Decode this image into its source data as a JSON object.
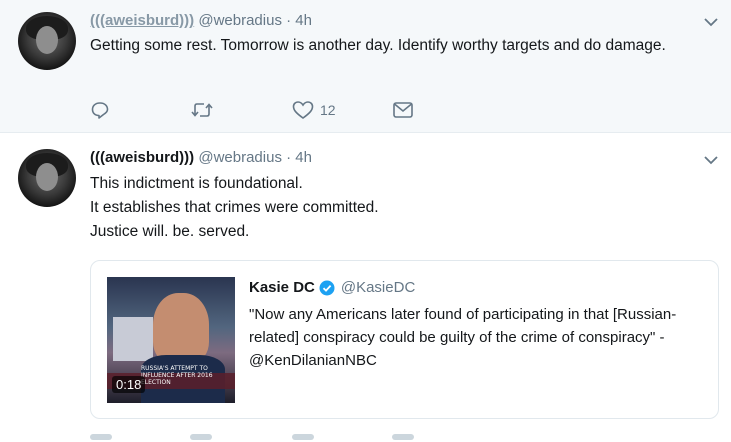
{
  "tweet1": {
    "display_name": "(((aweisburd)))",
    "handle": "@webradius",
    "separator": "·",
    "time": "4h",
    "text": "Getting some rest. Tomorrow is another day. Identify worthy targets and do damage.",
    "likes_count": "12"
  },
  "tweet2": {
    "display_name": "(((aweisburd)))",
    "handle": "@webradius",
    "separator": "·",
    "time": "4h",
    "lines": [
      "This indictment is foundational.",
      "It establishes that crimes were committed.",
      "Justice will. be. served."
    ],
    "quote": {
      "name": "Kasie DC",
      "handle": "@KasieDC",
      "text": "\"Now any Americans later found of participating in that [Russian-related] conspiracy could be guilty of the crime of conspiracy\" - @KenDilanianNBC",
      "video_duration": "0:18",
      "banner_text": "RUSSIA'S ATTEMPT TO INFLUENCE AFTER 2016 ELECTION"
    }
  },
  "icons": {
    "reply": "reply-icon",
    "retweet": "retweet-icon",
    "like": "heart-icon",
    "dm": "envelope-icon",
    "caret": "chevron-down-icon",
    "verified": "verified-badge-icon"
  },
  "colors": {
    "muted": "#657786",
    "verified": "#1da1f2",
    "selected_background": "#f5f8fa"
  }
}
